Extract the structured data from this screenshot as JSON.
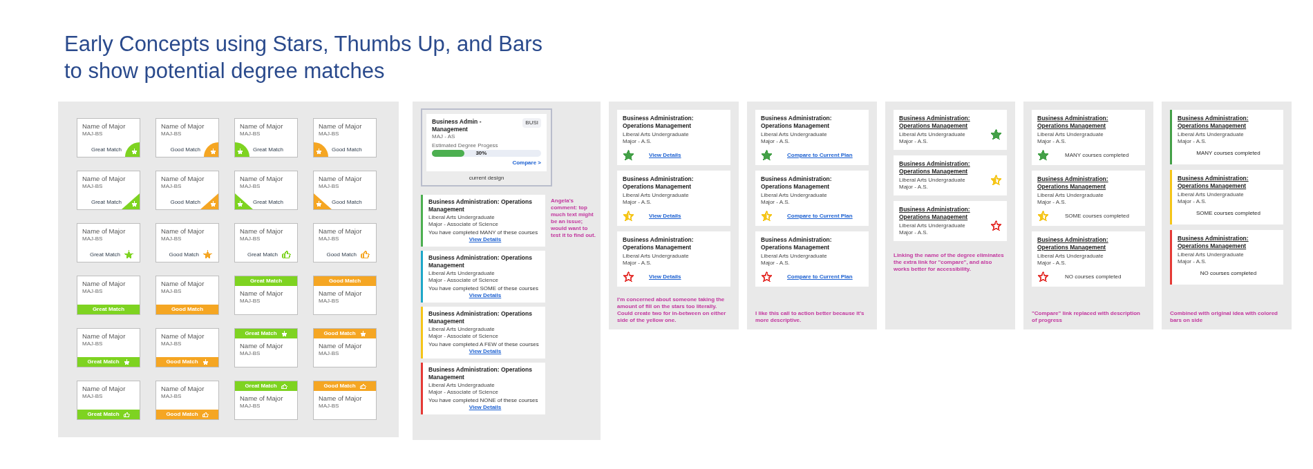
{
  "title_lines": [
    "Early Concepts using Stars, Thumbs Up, and Bars",
    "to show potential degree matches"
  ],
  "grid_board": {
    "cards": [
      {
        "kind": "circle-right-star",
        "color": "#7ed321",
        "title": "Name of Major",
        "code": "MAJ-BS",
        "match": "Great Match"
      },
      {
        "kind": "circle-right-star",
        "color": "#f5a623",
        "title": "Name of Major",
        "code": "MAJ-BS",
        "match": "Good Match"
      },
      {
        "kind": "circle-left-star",
        "color": "#7ed321",
        "title": "Name of Major",
        "code": "MAJ-BS",
        "match": "Great Match"
      },
      {
        "kind": "circle-left-star",
        "color": "#f5a623",
        "title": "Name of Major",
        "code": "MAJ-BS",
        "match": "Good Match"
      },
      {
        "kind": "triangle-right-star",
        "color": "#7ed321",
        "title": "Name of Major",
        "code": "MAJ-BS",
        "match": "Great Match"
      },
      {
        "kind": "triangle-right-star",
        "color": "#f5a623",
        "title": "Name of Major",
        "code": "MAJ-BS",
        "match": "Good Match"
      },
      {
        "kind": "triangle-left-star",
        "color": "#7ed321",
        "title": "Name of Major",
        "code": "MAJ-BS",
        "match": "Great Match"
      },
      {
        "kind": "triangle-left-star",
        "color": "#f5a623",
        "title": "Name of Major",
        "code": "MAJ-BS",
        "match": "Good Match"
      },
      {
        "kind": "inline-star",
        "color": "#7ed321",
        "title": "Name of Major",
        "code": "MAJ-BS",
        "match": "Great Match"
      },
      {
        "kind": "inline-star",
        "color": "#f5a623",
        "title": "Name of Major",
        "code": "MAJ-BS",
        "match": "Good Match"
      },
      {
        "kind": "inline-thumb",
        "color": "#7ed321",
        "title": "Name of Major",
        "code": "MAJ-BS",
        "match": "Great Match"
      },
      {
        "kind": "inline-thumb",
        "color": "#f5a623",
        "title": "Name of Major",
        "code": "MAJ-BS",
        "match": "Good Match"
      },
      {
        "kind": "banner-bottom",
        "color": "#7ed321",
        "title": "Name of Major",
        "code": "MAJ-BS",
        "match": "Great Match"
      },
      {
        "kind": "banner-bottom",
        "color": "#f5a623",
        "title": "Name of Major",
        "code": "MAJ-BS",
        "match": "Good Match"
      },
      {
        "kind": "banner-top",
        "color": "#7ed321",
        "title": "Name of Major",
        "code": "MAJ-BS",
        "match": "Great Match"
      },
      {
        "kind": "banner-top",
        "color": "#f5a623",
        "title": "Name of Major",
        "code": "MAJ-BS",
        "match": "Good Match"
      },
      {
        "kind": "banner-bottom-star",
        "color": "#7ed321",
        "title": "Name of Major",
        "code": "MAJ-BS",
        "match": "Great Match"
      },
      {
        "kind": "banner-bottom-star",
        "color": "#f5a623",
        "title": "Name of Major",
        "code": "MAJ-BS",
        "match": "Good Match"
      },
      {
        "kind": "banner-top-star",
        "color": "#7ed321",
        "title": "Name of Major",
        "code": "MAJ-BS",
        "match": "Great Match"
      },
      {
        "kind": "banner-top-star",
        "color": "#f5a623",
        "title": "Name of Major",
        "code": "MAJ-BS",
        "match": "Good Match"
      },
      {
        "kind": "banner-bottom-thumb",
        "color": "#7ed321",
        "title": "Name of Major",
        "code": "MAJ-BS",
        "match": "Great Match"
      },
      {
        "kind": "banner-bottom-thumb",
        "color": "#f5a623",
        "title": "Name of Major",
        "code": "MAJ-BS",
        "match": "Good Match"
      },
      {
        "kind": "banner-top-thumb",
        "color": "#7ed321",
        "title": "Name of Major",
        "code": "MAJ-BS",
        "match": "Great Match"
      },
      {
        "kind": "banner-top-thumb",
        "color": "#f5a623",
        "title": "Name of Major",
        "code": "MAJ-BS",
        "match": "Good Match"
      }
    ]
  },
  "current_design_board": {
    "current": {
      "title": "Business Admin - Management",
      "badge": "BUSI",
      "code": "MAJ - AS",
      "progress_label": "Estimated Degree Progess",
      "level": 0.3,
      "reading": "30%",
      "link": "Compare >"
    },
    "caption": "current design",
    "note": "Angela's comment: top much text might be an issue; would want to test it to find out.",
    "cards": [
      {
        "color": "#4caf50",
        "title": "Business Administration: Operations Management",
        "line1": "Liberal Arts Undergraduate",
        "line2": "Major - Associate of Science",
        "status": "You have completed MANY of these courses",
        "link": "View Details"
      },
      {
        "color": "#1ea7c8",
        "title": "Business Administration: Operations Management",
        "line1": "Liberal Arts Undergraduate",
        "line2": "Major - Associate of Science",
        "status": "You have completed SOME of these courses",
        "link": "View Details"
      },
      {
        "color": "#f5c518",
        "title": "Business Administration: Operations Management",
        "line1": "Liberal Arts Undergraduate",
        "line2": "Major - Associate of Science",
        "status": "You have completed A FEW of these courses",
        "link": "View Details"
      },
      {
        "color": "#e53935",
        "title": "Business Administration: Operations Management",
        "line1": "Liberal Arts Undergraduate",
        "line2": "Major - Associate of Science",
        "status": "You have completed NONE of these courses",
        "link": "View Details"
      }
    ]
  },
  "concept_boards": [
    {
      "kind": "star-link",
      "note": "I'm concerned about someone taking the amount of fill on the stars too literally.  Could create two for in-between on either side of the yellow one.",
      "cards": [
        {
          "kind": "full-star",
          "title": "Business Administration: Operations Management",
          "line1": "Liberal Arts Undergraduate",
          "line2": "Major - A.S.",
          "color": "#43a047",
          "link": "View Details"
        },
        {
          "kind": "half-star",
          "title": "Business Administration: Operations Management",
          "line1": "Liberal Arts Undergraduate",
          "line2": "Major - A.S.",
          "color": "#f5c518",
          "link": "View Details"
        },
        {
          "kind": "empty-star",
          "title": "Business Administration: Operations Management",
          "line1": "Liberal Arts Undergraduate",
          "line2": "Major - A.S.",
          "color": "#e53935",
          "link": "View Details"
        }
      ]
    },
    {
      "kind": "star-link",
      "note": "I like this call to action better because it's more descriptive.",
      "cards": [
        {
          "kind": "full-star",
          "title": "Business Administration: Operations Management",
          "line1": "Liberal Arts Undergraduate",
          "line2": "Major - A.S.",
          "color": "#43a047",
          "link": "Compare to Current Plan"
        },
        {
          "kind": "half-star",
          "title": "Business Administration: Operations Management",
          "line1": "Liberal Arts Undergraduate",
          "line2": "Major - A.S.",
          "color": "#f5c518",
          "link": "Compare to Current Plan"
        },
        {
          "kind": "empty-star",
          "title": "Business Administration: Operations Management",
          "line1": "Liberal Arts Undergraduate",
          "line2": "Major - A.S.",
          "color": "#e53935",
          "link": "Compare to Current Plan"
        }
      ]
    },
    {
      "kind": "star-side",
      "note": "Linking the name of the degree eliminates the extra link for \"compare\", and also works better for accessibility.",
      "cards": [
        {
          "kind": "full-star",
          "title": "Business Administration: Operations Management",
          "line1": "Liberal Arts Undergraduate",
          "line2": "Major - A.S.",
          "color": "#43a047"
        },
        {
          "kind": "half-star",
          "title": "Business Administration: Operations Management",
          "line1": "Liberal Arts Undergraduate",
          "line2": "Major - A.S.",
          "color": "#f5c518"
        },
        {
          "kind": "empty-star",
          "title": "Business Administration: Operations Management",
          "line1": "Liberal Arts Undergraduate",
          "line2": "Major - A.S.",
          "color": "#e53935"
        }
      ]
    },
    {
      "kind": "star-status",
      "note": "\"Compare\" link replaced with description of progress",
      "cards": [
        {
          "kind": "full-star",
          "title": "Business Administration: Operations Management",
          "line1": "Liberal Arts Undergraduate",
          "line2": "Major - A.S.",
          "color": "#43a047",
          "status": "MANY courses completed"
        },
        {
          "kind": "half-star",
          "title": "Business Administration: Operations Management",
          "line1": "Liberal Arts Undergraduate",
          "line2": "Major - A.S.",
          "color": "#f5c518",
          "status": "SOME courses completed"
        },
        {
          "kind": "empty-star",
          "title": "Business Administration: Operations Management",
          "line1": "Liberal Arts Undergraduate",
          "line2": "Major - A.S.",
          "color": "#e53935",
          "status": "NO courses completed"
        }
      ]
    },
    {
      "kind": "bar-status",
      "note": "Combined with original idea with colored bars on side",
      "cards": [
        {
          "title": "Business Administration: Operations Management",
          "line1": "Liberal Arts Undergraduate",
          "line2": "Major - A.S.",
          "color": "#43a047",
          "status": "MANY courses completed"
        },
        {
          "title": "Business Administration: Operations Management",
          "line1": "Liberal Arts Undergraduate",
          "line2": "Major - A.S.",
          "color": "#f5c518",
          "status": "SOME courses completed"
        },
        {
          "title": "Business Administration: Operations Management",
          "line1": "Liberal Arts Undergraduate",
          "line2": "Major - A.S.",
          "color": "#e53935",
          "status": "NO courses completed"
        }
      ]
    }
  ]
}
